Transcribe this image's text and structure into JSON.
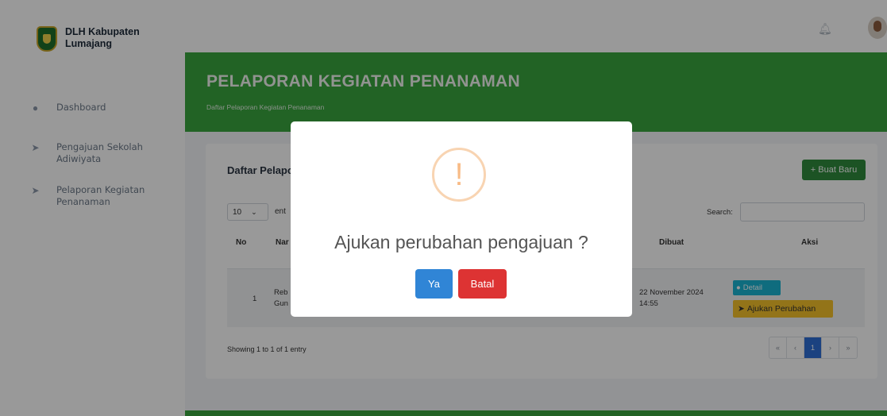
{
  "sidebar": {
    "brand": "DLH Kabupaten Lumajang",
    "items": [
      {
        "icon": "dashboard-icon",
        "label": "Dashboard"
      },
      {
        "icon": "paper-plane-icon",
        "label": "Pengajuan Sekolah Adiwiyata"
      },
      {
        "icon": "paper-plane-icon",
        "label": "Pelaporan Kegiatan Penanaman"
      }
    ]
  },
  "header": {
    "title": "PELAPORAN KEGIATAN PENANAMAN",
    "subtitle": "Daftar Pelaporan Kegiatan Penanaman"
  },
  "card": {
    "title": "Daftar Pelapo",
    "new_button": "+ Buat Baru",
    "length_value": "10",
    "entries_label": "ent",
    "search_label": "Search:",
    "search_value": "",
    "columns": [
      "No",
      "Nar",
      "Dibuat",
      "Aksi"
    ],
    "rows": [
      {
        "no": "1",
        "name_line1": "Reb",
        "name_line2": "Gun",
        "created_line1": "22 November 2024",
        "created_line2": "14:55",
        "detail_button": "Detail",
        "ajukan_button": "Ajukan Perubahan"
      }
    ],
    "footer_info": "Showing 1 to 1 of 1 entry",
    "pagination": [
      "«",
      "‹",
      "1",
      "›",
      "»"
    ]
  },
  "modal": {
    "icon": "warning-icon",
    "icon_glyph": "!",
    "title": "Ajukan perubahan pengajuan ?",
    "confirm": "Ya",
    "cancel": "Batal"
  },
  "colors": {
    "header_green": "#3aa63f",
    "confirm_blue": "#3085d6",
    "cancel_red": "#dd3333",
    "detail_cyan": "#19b4d3",
    "warning_yellow": "#f6c12a"
  }
}
